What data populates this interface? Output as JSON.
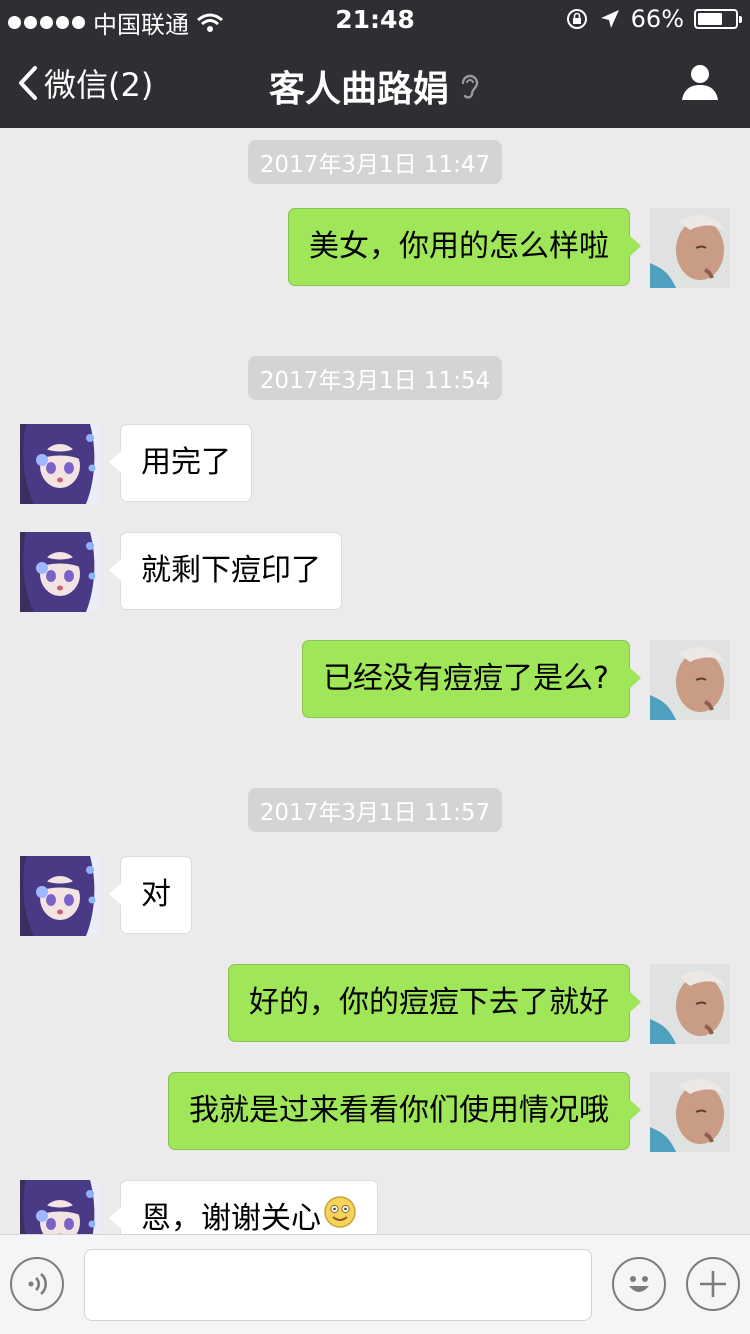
{
  "status_bar": {
    "carrier": "中国联通",
    "time": "21:48",
    "battery_text": "66%",
    "battery_level": 0.66
  },
  "nav": {
    "back_label": "微信(2)",
    "title": "客人曲路娟"
  },
  "messages": [
    {
      "kind": "timestamp",
      "text": "2017年3月1日 11:47"
    },
    {
      "kind": "message",
      "side": "me",
      "text": "美女，你用的怎么样啦"
    },
    {
      "kind": "timestamp",
      "text": "2017年3月1日 11:54"
    },
    {
      "kind": "message",
      "side": "them",
      "text": "用完了"
    },
    {
      "kind": "message",
      "side": "them",
      "text": "就剩下痘印了"
    },
    {
      "kind": "message",
      "side": "me",
      "text": "已经没有痘痘了是么?"
    },
    {
      "kind": "timestamp",
      "text": "2017年3月1日 11:57"
    },
    {
      "kind": "message",
      "side": "them",
      "text": "对"
    },
    {
      "kind": "message",
      "side": "me",
      "text": "好的，你的痘痘下去了就好"
    },
    {
      "kind": "message",
      "side": "me",
      "text": "我就是过来看看你们使用情况哦"
    },
    {
      "kind": "message",
      "side": "them",
      "text": "恩，谢谢关心",
      "emoji": "smile-emoji"
    }
  ],
  "icons": {
    "voice": "voice-icon",
    "emoji": "emoji-icon",
    "more": "plus-icon",
    "profile": "person-icon",
    "earpiece": "ear-icon"
  },
  "colors": {
    "my_bubble": "#9fe658",
    "their_bubble": "#ffffff",
    "nav_background": "#2e2e33",
    "chat_background": "#ebebeb"
  }
}
